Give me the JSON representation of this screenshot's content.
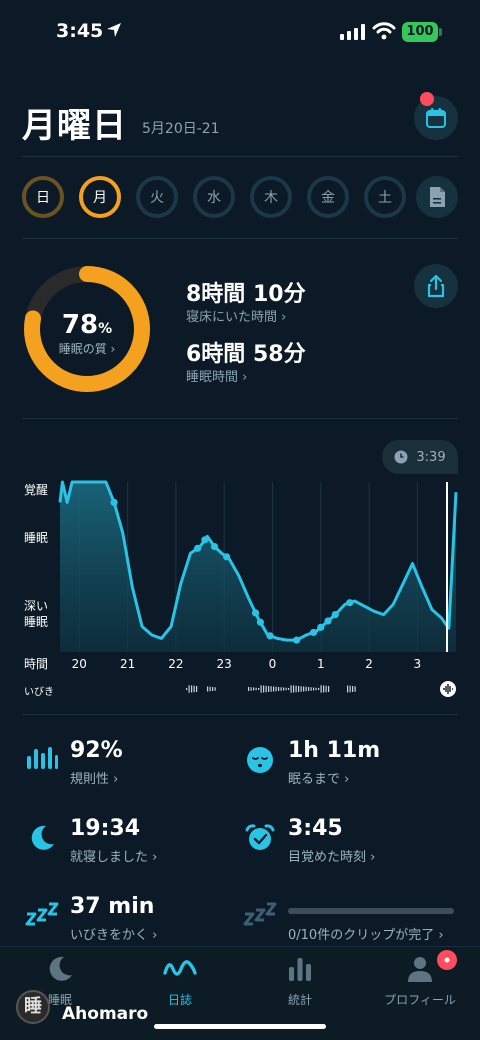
{
  "status_bar": {
    "time": "3:45",
    "battery": "100"
  },
  "header": {
    "day": "月曜日",
    "date_range": "5月20日-21"
  },
  "week": [
    {
      "label": "日",
      "state": "past"
    },
    {
      "label": "月",
      "state": "selected"
    },
    {
      "label": "火",
      "state": "empty"
    },
    {
      "label": "水",
      "state": "empty"
    },
    {
      "label": "木",
      "state": "empty"
    },
    {
      "label": "金",
      "state": "empty"
    },
    {
      "label": "土",
      "state": "empty"
    }
  ],
  "summary": {
    "quality_value": "78",
    "quality_unit": "%",
    "quality_fraction": 0.78,
    "quality_label": "睡眠の質 ›",
    "time_in_bed": "8時間 10分",
    "time_in_bed_label": "寝床にいた時間 ›",
    "time_asleep": "6時間 58分",
    "time_asleep_label": "睡眠時間 ›"
  },
  "chart": {
    "current_time": "3:39",
    "y_labels": {
      "awake": "覚醒",
      "sleep": "睡眠",
      "deep_line1": "深い",
      "deep_line2": "睡眠"
    },
    "x_axis_label": "時間",
    "snore_label": "いびき"
  },
  "chart_data": {
    "type": "area",
    "x_ticks": [
      "20",
      "21",
      "22",
      "23",
      "0",
      "1",
      "2",
      "3"
    ],
    "y_categories": [
      "深い睡眠",
      "睡眠",
      "覚醒"
    ],
    "y_range": [
      0,
      100
    ],
    "x_range_hours": [
      19.6,
      27.8
    ],
    "series": [
      {
        "x": [
          19.6,
          19.65,
          19.75,
          19.85,
          20.0,
          20.3,
          20.55,
          20.72,
          20.9,
          21.1,
          21.3,
          21.5,
          21.7,
          21.9,
          22.1,
          22.3,
          22.5,
          22.65,
          22.8,
          22.95,
          23.1,
          23.3,
          23.5,
          23.7,
          23.9,
          24.1,
          24.3,
          24.5,
          24.7,
          24.9,
          25.1,
          25.3,
          25.5,
          25.7,
          25.9,
          26.1,
          26.3,
          26.5,
          26.7,
          26.9,
          27.1,
          27.3,
          27.5,
          27.65,
          27.72,
          27.8
        ],
        "values": [
          88,
          100,
          88,
          100,
          100,
          100,
          100,
          88,
          70,
          38,
          15,
          10,
          8,
          15,
          40,
          58,
          62,
          68,
          62,
          58,
          55,
          45,
          32,
          20,
          10,
          8,
          7,
          7,
          10,
          12,
          17,
          22,
          28,
          30,
          27,
          24,
          22,
          28,
          40,
          52,
          38,
          25,
          20,
          14,
          50,
          94
        ]
      }
    ],
    "markers_x": [
      20.72,
      22.45,
      22.6,
      22.8,
      23.05,
      23.65,
      23.75,
      23.95,
      24.5,
      24.85,
      25.0,
      25.15,
      25.3,
      25.6
    ]
  },
  "stats": [
    {
      "icon": "regularity-icon",
      "value": "92%",
      "label": "規則性 ›"
    },
    {
      "icon": "sleepy-face-icon",
      "value": "1h 11m",
      "label": "眠るまで ›"
    },
    {
      "icon": "moon-icon",
      "value": "19:34",
      "label": "就寝しました ›"
    },
    {
      "icon": "alarm-clock-icon",
      "value": "3:45",
      "label": "目覚めた時刻 ›"
    },
    {
      "icon": "zzz-icon",
      "value": "37 min",
      "label": "いびきをかく ›"
    },
    {
      "icon": "zzz-icon",
      "value": "",
      "label": "0/10件のクリップが完了 ›"
    }
  ],
  "tabs": [
    {
      "label": "睡眠",
      "icon": "moon-icon",
      "active": false
    },
    {
      "label": "日誌",
      "icon": "wave-icon",
      "active": true
    },
    {
      "label": "統計",
      "icon": "bar-chart-icon",
      "active": false
    },
    {
      "label": "プロフィール",
      "icon": "person-icon",
      "active": false
    }
  ],
  "watermark": {
    "glyph": "睡",
    "name": "Ahomaro"
  },
  "colors": {
    "background": "#0b1a26",
    "accent": "#29c3e6",
    "ring": "#f3a11e",
    "badge": "#ff4d5e"
  }
}
